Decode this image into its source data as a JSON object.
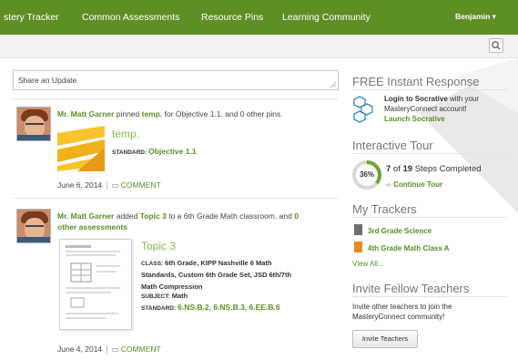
{
  "nav": {
    "items": [
      "stery Tracker",
      "Common Assessments",
      "Resource Pins",
      "Learning Community"
    ],
    "user": "Benjamin ▾"
  },
  "share": {
    "placeholder": "Share an Update"
  },
  "posts": [
    {
      "author": "Mr. Matt Garner",
      "action": " pinned ",
      "item": "temp.",
      "rest": " for Objective 1.1. and 0 other pins.",
      "title": "temp.",
      "standard_label": "STANDARD:",
      "standard": "Objective 1.1",
      "date": "June 6, 2014",
      "comment": "COMMENT"
    },
    {
      "author": "Mr. Matt Garner",
      "action": " added ",
      "item": "Topic 3",
      "rest": " to a 6th Grade Math classroom. and ",
      "rest_link": "0",
      "rest_link2": "other assessments",
      "title": "Topic 3",
      "class_label": "CLASS:",
      "class_l1": "6th Grade, KIPP Nashville 6 Math",
      "class_l2": "Standards, Custom 6th Grade Set, JSD 6th/7th",
      "class_l3": "Math Compression",
      "subject_label": "SUBJECT:",
      "subject": "Math",
      "standard_label": "STANDARD:",
      "standards": "6.NS.B.2, 6.NS.B.3, 6.EE.B.6",
      "date": "June 4, 2014",
      "comment": "COMMENT"
    }
  ],
  "sidebar": {
    "free_title": "FREE Instant Response",
    "free_text_1": "Login to Socrative",
    "free_text_2": " with your",
    "free_text_3": "MasteryConnect account!",
    "free_link": "Launch Socrative",
    "tour_title": "Interactive Tour",
    "tour_percent_label": "36%",
    "tour_percent": 36,
    "tour_steps_done": "7",
    "tour_steps_of": " of ",
    "tour_steps_total": "19",
    "tour_steps_suffix": " Steps Completed",
    "tour_link": "Continue Tour",
    "trackers_title": "My Trackers",
    "trackers": [
      {
        "label": "3rd Grade Science",
        "color": "#6f6f6f"
      },
      {
        "label": "4th Grade Math Class A",
        "color": "#e88b1a"
      }
    ],
    "view_all": "View All...",
    "invite_title": "Invite Fellow Teachers",
    "invite_text_1": "Invite other teachers to join the",
    "invite_text_2": "MasteryConnect community!",
    "invite_button": "Invite Teachers"
  }
}
